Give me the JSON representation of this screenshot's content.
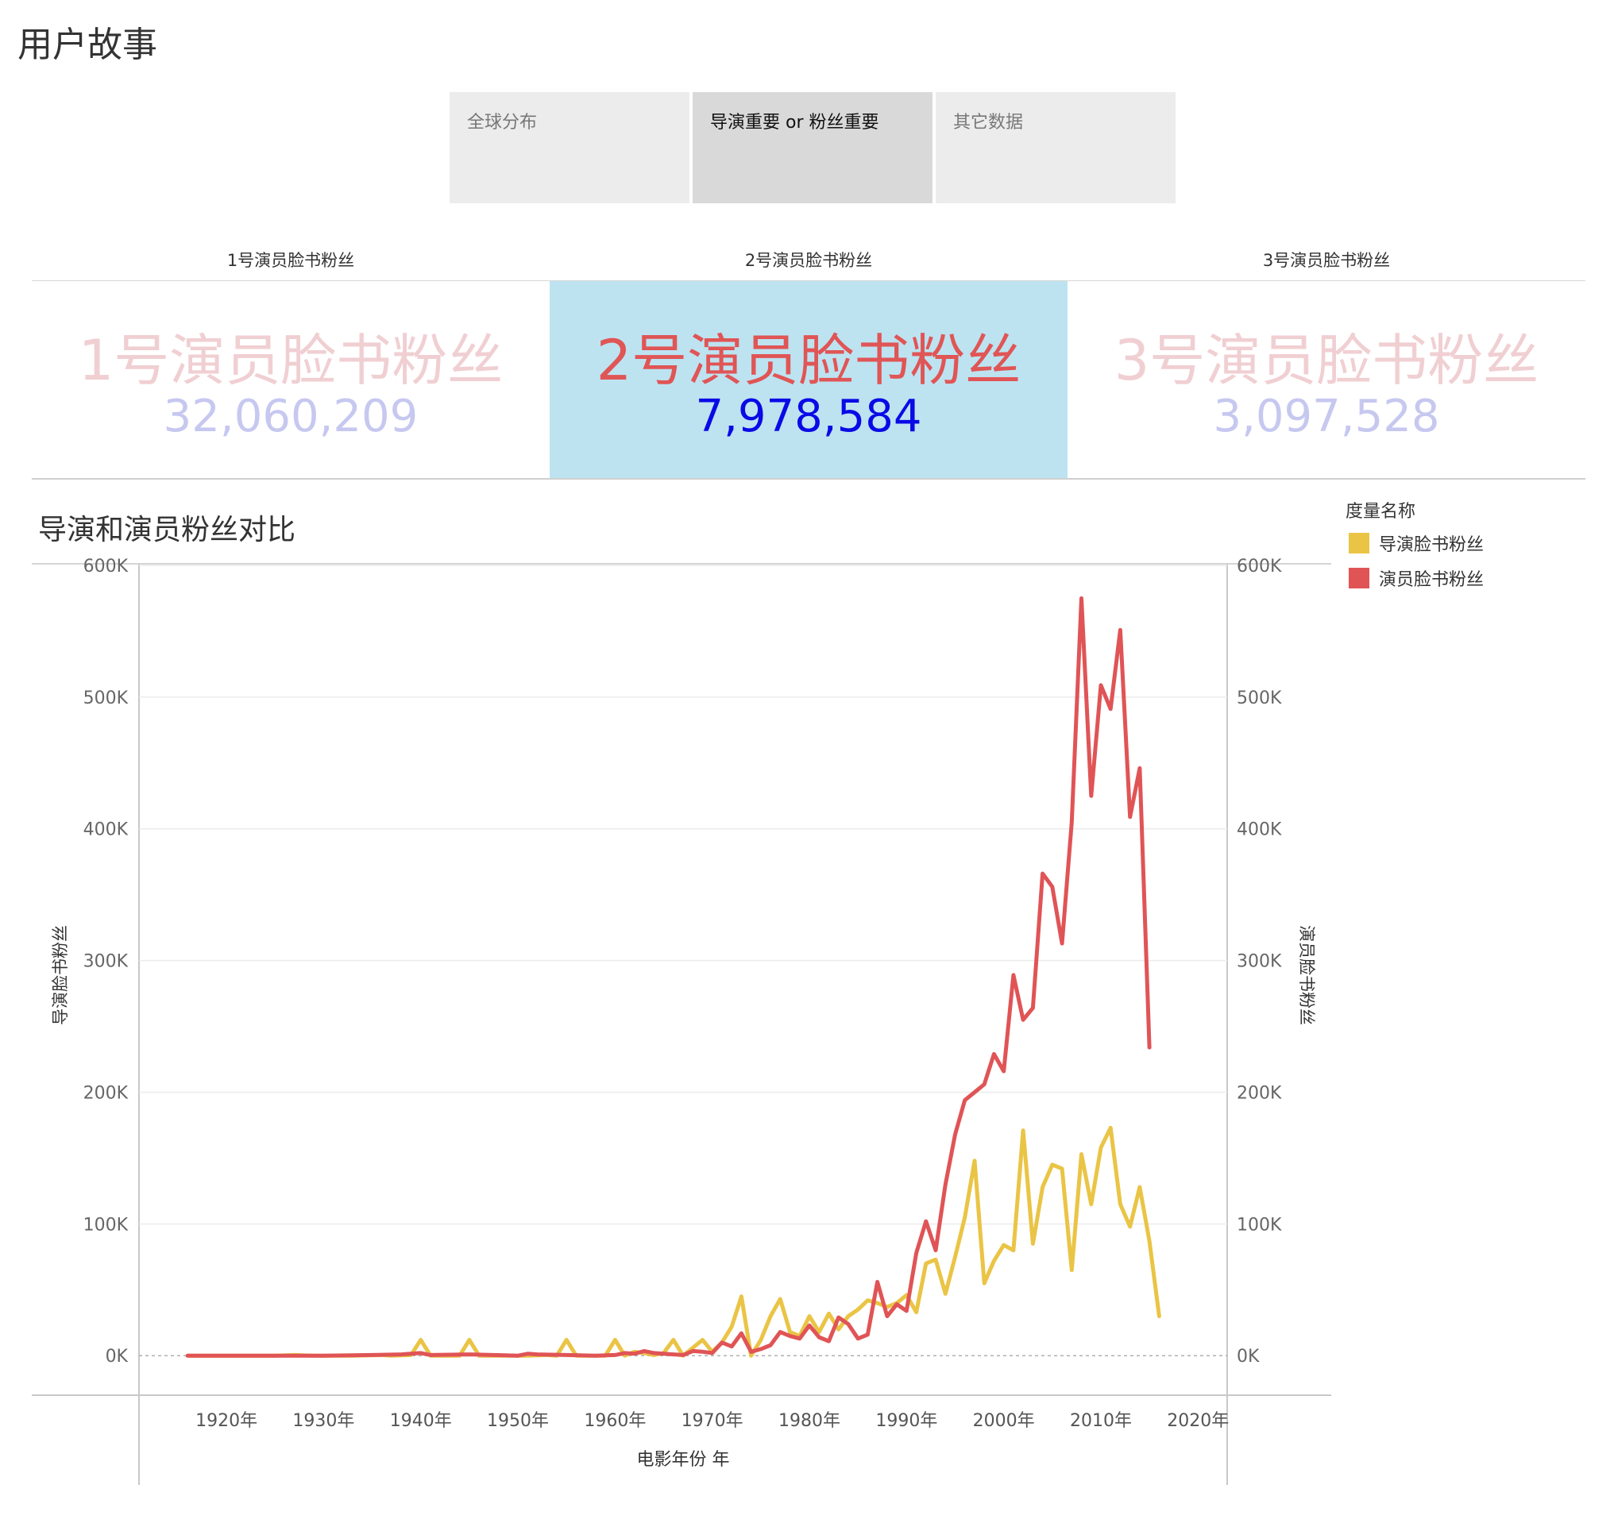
{
  "page": {
    "title": "用户故事"
  },
  "tabs": [
    {
      "label": "全球分布",
      "active": false
    },
    {
      "label": "导演重要 or 粉丝重要",
      "active": true
    },
    {
      "label": "其它数据",
      "active": false
    }
  ],
  "kpis": [
    {
      "header": "1号演员脸书粉丝",
      "name": "1号演员脸书粉丝",
      "value": "32,060,209",
      "selected": false
    },
    {
      "header": "2号演员脸书粉丝",
      "name": "2号演员脸书粉丝",
      "value": "7,978,584",
      "selected": true
    },
    {
      "header": "3号演员脸书粉丝",
      "name": "3号演员脸书粉丝",
      "value": "3,097,528",
      "selected": false
    }
  ],
  "chart": {
    "title": "导演和演员粉丝对比",
    "legend_title": "度量名称"
  },
  "colors": {
    "director": "#eac445",
    "actor": "#e05456",
    "selected_bg": "#bde3f1"
  },
  "chart_data": {
    "type": "line",
    "title": "导演和演员粉丝对比",
    "xlabel": "电影年份 年",
    "ylabel_left": "导演脸书粉丝",
    "ylabel_right": "演员脸书粉丝",
    "xlim": [
      1911,
      2023
    ],
    "ylim": [
      -30000,
      600000
    ],
    "y_ticks": [
      0,
      100000,
      200000,
      300000,
      400000,
      500000,
      600000
    ],
    "y_tick_labels": [
      "0K",
      "100K",
      "200K",
      "300K",
      "400K",
      "500K",
      "600K"
    ],
    "x_ticks": [
      1920,
      1930,
      1940,
      1950,
      1960,
      1970,
      1980,
      1990,
      2000,
      2010,
      2020
    ],
    "x_tick_labels": [
      "1920年",
      "1930年",
      "1940年",
      "1950年",
      "1960年",
      "1970年",
      "1980年",
      "1990年",
      "2000年",
      "2010年",
      "2020年"
    ],
    "grid": true,
    "legend_position": "top-right",
    "series": [
      {
        "name": "导演脸书粉丝",
        "points": [
          [
            1916,
            0
          ],
          [
            1920,
            0
          ],
          [
            1925,
            0
          ],
          [
            1927,
            500
          ],
          [
            1929,
            0
          ],
          [
            1933,
            0
          ],
          [
            1936,
            500
          ],
          [
            1937,
            0
          ],
          [
            1939,
            500
          ],
          [
            1940,
            12000
          ],
          [
            1941,
            0
          ],
          [
            1944,
            0
          ],
          [
            1945,
            12000
          ],
          [
            1946,
            0
          ],
          [
            1950,
            0
          ],
          [
            1951,
            0
          ],
          [
            1953,
            500
          ],
          [
            1954,
            0
          ],
          [
            1955,
            12000
          ],
          [
            1956,
            0
          ],
          [
            1959,
            0
          ],
          [
            1960,
            12000
          ],
          [
            1961,
            0
          ],
          [
            1962,
            3000
          ],
          [
            1963,
            2000
          ],
          [
            1964,
            500
          ],
          [
            1965,
            2000
          ],
          [
            1966,
            12000
          ],
          [
            1967,
            0
          ],
          [
            1969,
            12000
          ],
          [
            1970,
            3000
          ],
          [
            1971,
            10000
          ],
          [
            1972,
            22000
          ],
          [
            1973,
            45000
          ],
          [
            1974,
            0
          ],
          [
            1975,
            12000
          ],
          [
            1976,
            30000
          ],
          [
            1977,
            43000
          ],
          [
            1978,
            18000
          ],
          [
            1979,
            15000
          ],
          [
            1980,
            30000
          ],
          [
            1981,
            18000
          ],
          [
            1982,
            32000
          ],
          [
            1983,
            20000
          ],
          [
            1984,
            30000
          ],
          [
            1985,
            35000
          ],
          [
            1986,
            42000
          ],
          [
            1987,
            40000
          ],
          [
            1988,
            37000
          ],
          [
            1989,
            40000
          ],
          [
            1990,
            46000
          ],
          [
            1991,
            33000
          ],
          [
            1992,
            70000
          ],
          [
            1993,
            73000
          ],
          [
            1994,
            47000
          ],
          [
            1995,
            75000
          ],
          [
            1996,
            105000
          ],
          [
            1997,
            148000
          ],
          [
            1998,
            55000
          ],
          [
            1999,
            72000
          ],
          [
            2000,
            84000
          ],
          [
            2001,
            80000
          ],
          [
            2002,
            171000
          ],
          [
            2003,
            85000
          ],
          [
            2004,
            128000
          ],
          [
            2005,
            145000
          ],
          [
            2006,
            142000
          ],
          [
            2007,
            65000
          ],
          [
            2008,
            153000
          ],
          [
            2009,
            115000
          ],
          [
            2010,
            158000
          ],
          [
            2011,
            173000
          ],
          [
            2012,
            115000
          ],
          [
            2013,
            98000
          ],
          [
            2014,
            128000
          ],
          [
            2015,
            87000
          ],
          [
            2016,
            30000
          ]
        ]
      },
      {
        "name": "演员脸书粉丝",
        "points": [
          [
            1916,
            0
          ],
          [
            1920,
            0
          ],
          [
            1925,
            0
          ],
          [
            1930,
            0
          ],
          [
            1935,
            500
          ],
          [
            1938,
            1000
          ],
          [
            1940,
            2000
          ],
          [
            1941,
            500
          ],
          [
            1945,
            1000
          ],
          [
            1950,
            0
          ],
          [
            1951,
            1500
          ],
          [
            1952,
            1000
          ],
          [
            1955,
            500
          ],
          [
            1958,
            0
          ],
          [
            1960,
            500
          ],
          [
            1961,
            2000
          ],
          [
            1962,
            1500
          ],
          [
            1963,
            3500
          ],
          [
            1964,
            2000
          ],
          [
            1965,
            1500
          ],
          [
            1966,
            1000
          ],
          [
            1967,
            500
          ],
          [
            1968,
            3500
          ],
          [
            1969,
            3000
          ],
          [
            1970,
            2000
          ],
          [
            1971,
            10000
          ],
          [
            1972,
            7000
          ],
          [
            1973,
            17000
          ],
          [
            1974,
            3000
          ],
          [
            1975,
            5000
          ],
          [
            1976,
            8000
          ],
          [
            1977,
            18000
          ],
          [
            1978,
            15000
          ],
          [
            1979,
            13000
          ],
          [
            1980,
            23000
          ],
          [
            1981,
            14000
          ],
          [
            1982,
            11000
          ],
          [
            1983,
            29000
          ],
          [
            1984,
            24000
          ],
          [
            1985,
            13000
          ],
          [
            1986,
            16000
          ],
          [
            1987,
            56000
          ],
          [
            1988,
            30000
          ],
          [
            1989,
            39000
          ],
          [
            1990,
            34000
          ],
          [
            1991,
            78000
          ],
          [
            1992,
            102000
          ],
          [
            1993,
            80000
          ],
          [
            1994,
            130000
          ],
          [
            1995,
            168000
          ],
          [
            1996,
            194000
          ],
          [
            1997,
            200000
          ],
          [
            1998,
            206000
          ],
          [
            1999,
            229000
          ],
          [
            2000,
            216000
          ],
          [
            2001,
            289000
          ],
          [
            2002,
            255000
          ],
          [
            2003,
            264000
          ],
          [
            2004,
            366000
          ],
          [
            2005,
            356000
          ],
          [
            2006,
            313000
          ],
          [
            2007,
            405000
          ],
          [
            2008,
            575000
          ],
          [
            2009,
            425000
          ],
          [
            2010,
            509000
          ],
          [
            2011,
            491000
          ],
          [
            2012,
            551000
          ],
          [
            2013,
            409000
          ],
          [
            2014,
            446000
          ],
          [
            2015,
            234000
          ]
        ]
      }
    ]
  }
}
